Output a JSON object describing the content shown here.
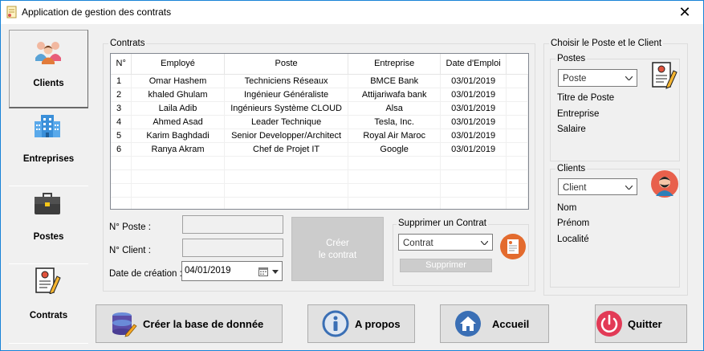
{
  "window": {
    "title": "Application de gestion des contrats",
    "close_glyph": "✕"
  },
  "sidebar": {
    "items": [
      {
        "label": "Clients",
        "icon": "people-icon"
      },
      {
        "label": "Entreprises",
        "icon": "building-icon"
      },
      {
        "label": "Postes",
        "icon": "briefcase-icon"
      },
      {
        "label": "Contrats",
        "icon": "contract-icon"
      }
    ]
  },
  "contrats": {
    "group_title": "Contrats",
    "columns": [
      "N°",
      "Employé",
      "Poste",
      "Entreprise",
      "Date d'Emploi"
    ],
    "rows": [
      [
        "1",
        "Omar Hashem",
        "Techniciens Réseaux",
        "BMCE Bank",
        "03/01/2019"
      ],
      [
        "2",
        "khaled Ghulam",
        "Ingénieur Généraliste",
        "Attijariwafa bank",
        "03/01/2019"
      ],
      [
        "3",
        "Laila Adib",
        "Ingénieurs Système CLOUD",
        "Alsa",
        "03/01/2019"
      ],
      [
        "4",
        "Ahmed Asad",
        "Leader Technique",
        "Tesla, Inc.",
        "03/01/2019"
      ],
      [
        "5",
        "Karim Baghdadi",
        "Senior Developper/Architect",
        "Royal Air Maroc",
        "03/01/2019"
      ],
      [
        "6",
        "Ranya Akram",
        "Chef de Projet IT",
        "Google",
        "03/01/2019"
      ]
    ]
  },
  "form": {
    "poste_label": "N° Poste :",
    "client_label": "N° Client :",
    "date_label": "Date de création :",
    "date_value": "04/01/2019",
    "create_button": [
      "Créer",
      "le contrat"
    ]
  },
  "supprimer": {
    "group_title": "Supprimer un Contrat",
    "combo_value": "Contrat",
    "button_label": "Supprimer"
  },
  "choisir": {
    "group_title": "Choisir  le Poste et le Client",
    "postes": {
      "title": "Postes",
      "combo_value": "Poste",
      "fields": [
        "Titre de Poste",
        "Entreprise",
        "Salaire"
      ]
    },
    "clients": {
      "title": "Clients",
      "combo_value": "Client",
      "fields": [
        "Nom",
        "Prénom",
        "Localité"
      ]
    }
  },
  "bottom_buttons": [
    {
      "label": "Créer la base de donnée",
      "icon": "database-icon"
    },
    {
      "label": "A propos",
      "icon": "info-icon"
    },
    {
      "label": "Accueil",
      "icon": "home-icon"
    },
    {
      "label": "Quitter",
      "icon": "power-icon"
    }
  ],
  "colors": {
    "accent": "#1883d7",
    "info": "#3a6fb5",
    "power": "#e23a56",
    "avatar_bg": "#e8604c"
  }
}
